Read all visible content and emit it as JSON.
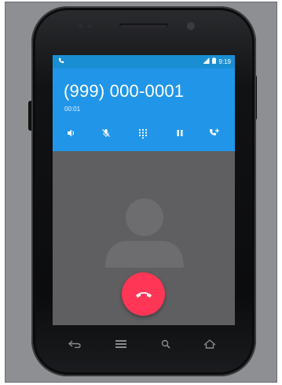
{
  "status_bar": {
    "time": "9:19",
    "phone_icon": "phone-icon",
    "signal_icon": "signal-icon",
    "battery_icon": "battery-icon"
  },
  "call": {
    "number": "(999) 000-0001",
    "elapsed": "00:01"
  },
  "actions": [
    {
      "name": "speaker-icon"
    },
    {
      "name": "mute-icon"
    },
    {
      "name": "dialpad-icon"
    },
    {
      "name": "pause-icon"
    },
    {
      "name": "add-call-icon"
    }
  ],
  "end_call": {
    "icon": "end-call-icon"
  },
  "nav_keys": [
    {
      "name": "back-icon"
    },
    {
      "name": "menu-icon"
    },
    {
      "name": "search-icon"
    },
    {
      "name": "home-icon"
    }
  ],
  "colors": {
    "header": "#2196e8",
    "status_bar": "#1a8ed3",
    "end_call": "#ff3656",
    "screen_bg": "#5f5e60"
  }
}
